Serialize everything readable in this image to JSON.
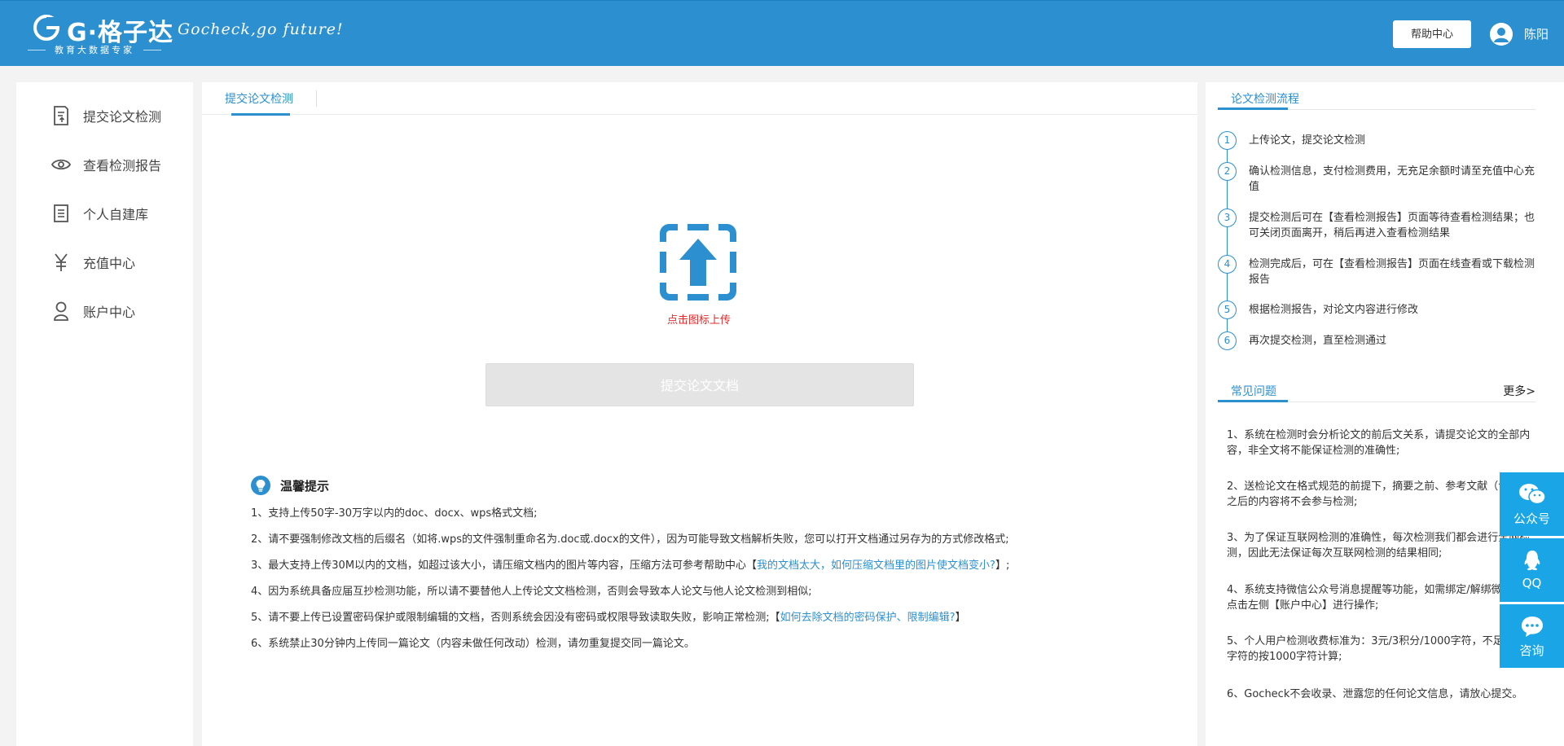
{
  "header": {
    "brand": "G·格子达",
    "brand_sub": "教育大数据专家",
    "slogan": "Gocheck,go future!",
    "help_label": "帮助中心",
    "username": "陈阳"
  },
  "sidebar": {
    "items": [
      {
        "label": "提交论文检测",
        "icon": "document-upload-icon"
      },
      {
        "label": "查看检测报告",
        "icon": "eye-icon"
      },
      {
        "label": "个人自建库",
        "icon": "file-list-icon"
      },
      {
        "label": "充值中心",
        "icon": "yen-icon"
      },
      {
        "label": "账户中心",
        "icon": "user-icon"
      }
    ]
  },
  "main": {
    "tab_label": "提交论文检测",
    "upload_hint": "点击图标上传",
    "submit_label": "提交论文文档",
    "tips_title": "温馨提示",
    "tips": [
      {
        "text": "1、支持上传50字-30万字以内的doc、docx、wps格式文档;",
        "link": "",
        "tail": ""
      },
      {
        "text": "2、请不要强制修改文档的后缀名（如将.wps的文件强制重命名为.doc或.docx的文件），因为可能导致文档解析失败，您可以打开文档通过另存为的方式修改格式;",
        "link": "",
        "tail": ""
      },
      {
        "text": "3、最大支持上传30M以内的文档，如超过该大小，请压缩文档内的图片等内容，压缩方法可参考帮助中心【",
        "link": "我的文档太大，如何压缩文档里的图片使文档变小?",
        "tail": "】;"
      },
      {
        "text": "4、因为系统具备应届互抄检测功能，所以请不要替他人上传论文文档检测，否则会导致本人论文与他人论文检测到相似;",
        "link": "",
        "tail": ""
      },
      {
        "text": "5、请不要上传已设置密码保护或限制编辑的文档，否则系统会因没有密码或权限导致读取失败，影响正常检测;【",
        "link": "如何去除文档的密码保护、限制编辑?",
        "tail": "】"
      },
      {
        "text": "6、系统禁止30分钟内上传同一篇论文（内容未做任何改动）检测，请勿重复提交同一篇论文。",
        "link": "",
        "tail": ""
      }
    ]
  },
  "right": {
    "process_title": "论文检测流程",
    "steps": [
      {
        "num": "1",
        "text": "上传论文，提交论文检测"
      },
      {
        "num": "2",
        "text": "确认检测信息，支付检测费用，无充足余额时请至充值中心充值"
      },
      {
        "num": "3",
        "text": "提交检测后可在【查看检测报告】页面等待查看检测结果；也可关闭页面离开，稍后再进入查看检测结果"
      },
      {
        "num": "4",
        "text": "检测完成后，可在【查看检测报告】页面在线查看或下载检测报告"
      },
      {
        "num": "5",
        "text": "根据检测报告，对论文内容进行修改"
      },
      {
        "num": "6",
        "text": "再次提交检测，直至检测通过"
      }
    ],
    "faq_title": "常见问题",
    "faq_more": "更多>",
    "faqs": [
      "1、系统在检测时会分析论文的前后文关系，请提交论文的全部内容，非全文将不能保证检测的准确性;",
      "2、送检论文在格式规范的前提下，摘要之前、参考文献（含）及之后的内容将不会参与检测;",
      "3、为了保证互联网检测的准确性，每次检测我们都会进行全网检测，因此无法保证每次互联网检测的结果相同;",
      "4、系统支持微信公众号消息提醒等功能，如需绑定/解绑微信，请点击左侧【账户中心】进行操作;",
      "5、个人用户检测收费标准为：3元/3积分/1000字符，不足1000字符的按1000字符计算;",
      "6、Gocheck不会收录、泄露您的任何论文信息，请放心提交。"
    ]
  },
  "float": {
    "wechat": "公众号",
    "qq": "QQ",
    "consult": "咨询"
  },
  "colors": {
    "primary": "#2b8fd0",
    "float_bg": "#1aa6e6",
    "hint_red": "#e32b2b"
  }
}
